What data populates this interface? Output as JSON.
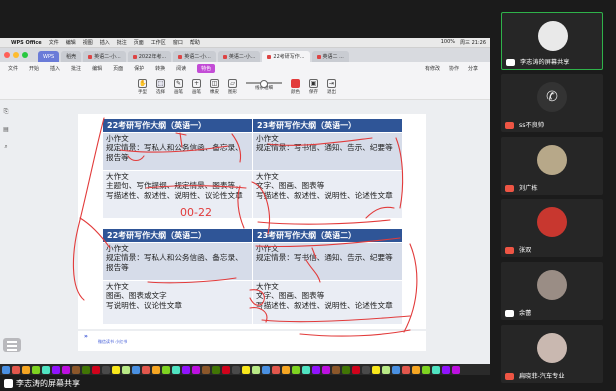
{
  "mac_menu": {
    "app": "WPS Office",
    "items": [
      "文件",
      "编辑",
      "视图",
      "插入",
      "批注",
      "页面",
      "工作区",
      "窗口",
      "帮助"
    ],
    "status": [
      "100%",
      "周三 21:26"
    ]
  },
  "wps_tabs": [
    {
      "label": "WPS"
    },
    {
      "label": "稻壳"
    },
    {
      "label": "英语二-小..."
    },
    {
      "label": "2022年考..."
    },
    {
      "label": "英语二-小..."
    },
    {
      "label": "英语二-小..."
    },
    {
      "label": "22考研写作..."
    },
    {
      "label": "英语二 ..."
    }
  ],
  "ribbon": {
    "file": "文件",
    "items": [
      "开始",
      "插入",
      "批注",
      "编辑",
      "页面",
      "保护",
      "转换",
      "阅读"
    ],
    "active": "特色",
    "share": "分享",
    "right": [
      "有修改",
      "协作",
      "分享"
    ]
  },
  "tools": [
    {
      "label": "手型",
      "icon": "hand-icon"
    },
    {
      "label": "选择",
      "icon": "select-icon"
    },
    {
      "label": "画笔",
      "icon": "pen-icon"
    },
    {
      "label": "画笔",
      "icon": "draw-icon"
    },
    {
      "label": "橡皮",
      "icon": "eraser-icon"
    },
    {
      "label": "图形",
      "icon": "shape-icon"
    },
    {
      "label": "线条粗细",
      "icon": "line-width-icon"
    },
    {
      "label": "颜色",
      "icon": "color-icon"
    },
    {
      "label": "保存",
      "icon": "save-icon"
    },
    {
      "label": "退出",
      "icon": "exit-icon"
    }
  ],
  "doc": {
    "table1": {
      "left_header": "22考研写作大纲（英语一）",
      "right_header": "23考研写作大纲（英语一）",
      "rows": [
        {
          "left": [
            "小作文",
            "规定情景：写私人和公务信函、备忘录、报告等"
          ],
          "right": [
            "小作文",
            "规定情景：写书信、通知、告示、纪要等"
          ]
        },
        {
          "left": [
            "大作文",
            "主题句、写作提纲、规定情景、图表等，写描述性、叙述性、说明性、议论性文章"
          ],
          "right": [
            "大作文",
            "文字、图画、图表等",
            "写描述性、叙述性、说明性、论述性文章"
          ]
        }
      ]
    },
    "table2": {
      "left_header": "22考研写作大纲（英语二）",
      "right_header": "23考研写作大纲（英语二）",
      "rows": [
        {
          "left": [
            "小作文",
            "规定情景：写私人和公务信函、备忘录、报告等"
          ],
          "right": [
            "小作文",
            "规定情景：写书信、通知、告示、纪要等"
          ]
        },
        {
          "left": [
            "大作文",
            "图画、图表或文字",
            "写说明性、议论性文章"
          ],
          "right": [
            "大作文",
            "文字、图画、图表等",
            "写描述性、叙述性、说明性、论述性文章"
          ]
        }
      ]
    },
    "handwriting": "00-22",
    "page_note": "微信读书 小红书"
  },
  "share_label": "李志涛的屏幕共享",
  "participants": [
    {
      "name": "李志涛的屏幕共享",
      "active": true,
      "mic": "on",
      "avatar_color": "#e9e9e9"
    },
    {
      "name": "ss不良帅",
      "active": false,
      "mic": "off",
      "avatar": "phone-icon"
    },
    {
      "name": "刘广栋",
      "active": false,
      "mic": "off",
      "avatar_color": "#b7a889"
    },
    {
      "name": "张双",
      "active": false,
      "mic": "off",
      "avatar_color": "#c8372f"
    },
    {
      "name": "余蕾",
      "active": false,
      "mic": "on",
      "avatar_color": "#9a8d85"
    },
    {
      "name": "扁晓菲-汽车专业",
      "active": false,
      "mic": "off",
      "avatar_color": "#c9b8b0"
    }
  ],
  "colors": {
    "header_blue": "#2f5597",
    "cell_blue": "#d6dce9",
    "ink_red": "#e23b3b",
    "active_green": "#2fb24a",
    "ribbon_active": "#c34cd6"
  }
}
